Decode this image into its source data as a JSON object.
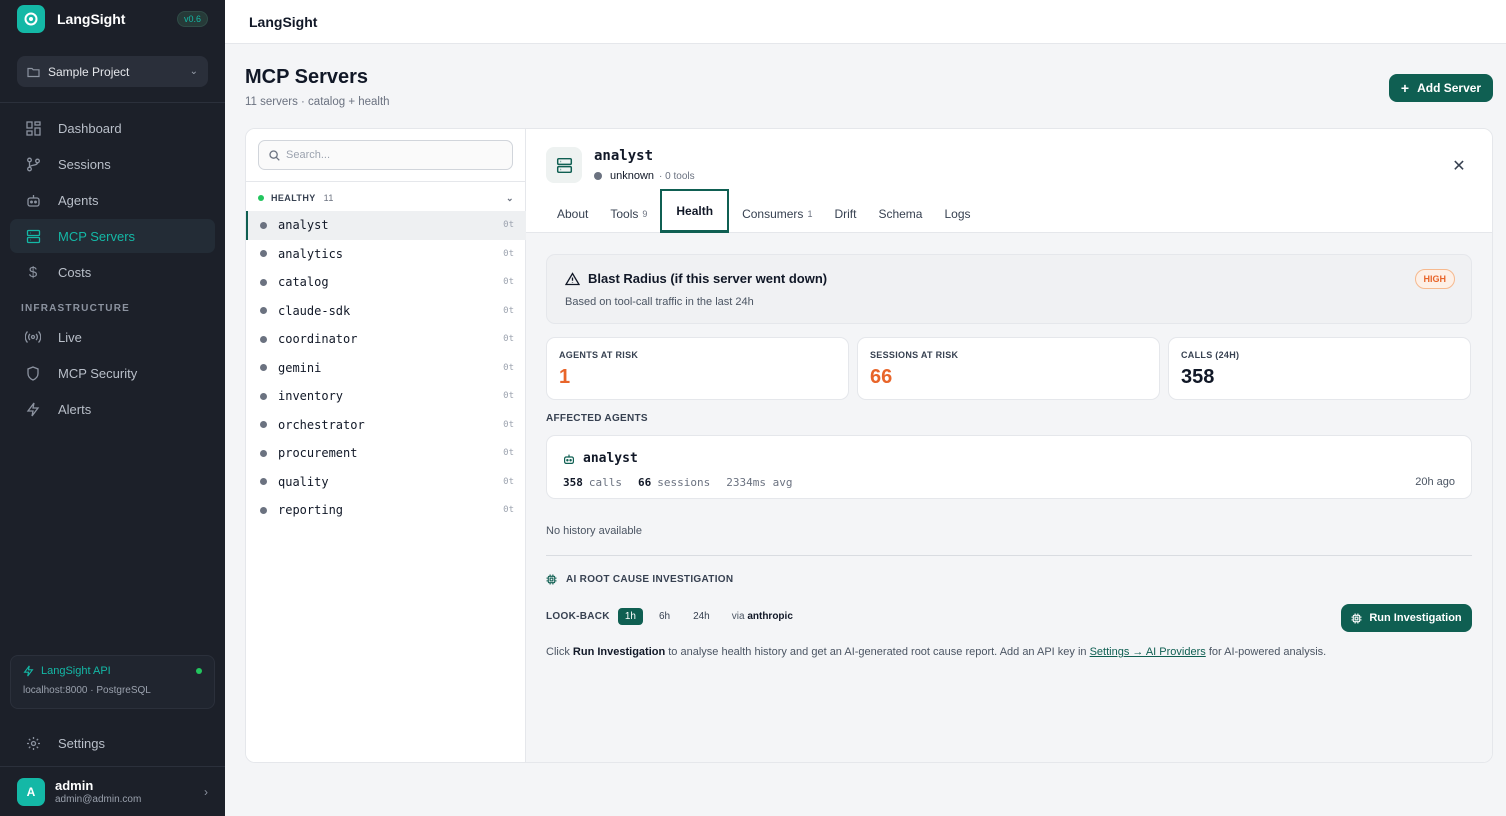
{
  "app": {
    "name": "LangSight",
    "version": "v0.6"
  },
  "project": {
    "name": "Sample Project"
  },
  "nav": {
    "items": [
      {
        "label": "Dashboard"
      },
      {
        "label": "Sessions"
      },
      {
        "label": "Agents"
      },
      {
        "label": "MCP Servers"
      },
      {
        "label": "Costs"
      }
    ],
    "infra_label": "INFRASTRUCTURE",
    "infra_items": [
      {
        "label": "Live"
      },
      {
        "label": "MCP Security"
      },
      {
        "label": "Alerts"
      }
    ],
    "settings_label": "Settings"
  },
  "api_status": {
    "title": "LangSight API",
    "detail": "localhost:8000 · PostgreSQL",
    "status_color": "#22c55e"
  },
  "user": {
    "initial": "A",
    "name": "admin",
    "email": "admin@admin.com"
  },
  "topbar": {
    "title": "LangSight"
  },
  "page": {
    "title": "MCP Servers",
    "subtitle": "11 servers · catalog + health",
    "add_button": "Add Server"
  },
  "search": {
    "placeholder": "Search..."
  },
  "group": {
    "label": "HEALTHY",
    "count": "11"
  },
  "servers": [
    {
      "name": "analyst",
      "tools": "0t"
    },
    {
      "name": "analytics",
      "tools": "0t"
    },
    {
      "name": "catalog",
      "tools": "0t"
    },
    {
      "name": "claude-sdk",
      "tools": "0t"
    },
    {
      "name": "coordinator",
      "tools": "0t"
    },
    {
      "name": "gemini",
      "tools": "0t"
    },
    {
      "name": "inventory",
      "tools": "0t"
    },
    {
      "name": "orchestrator",
      "tools": "0t"
    },
    {
      "name": "procurement",
      "tools": "0t"
    },
    {
      "name": "quality",
      "tools": "0t"
    },
    {
      "name": "reporting",
      "tools": "0t"
    }
  ],
  "detail": {
    "name": "analyst",
    "status": "unknown",
    "meta": "· 0 tools",
    "tabs": [
      {
        "label": "About",
        "count": ""
      },
      {
        "label": "Tools",
        "count": "9"
      },
      {
        "label": "Health",
        "count": ""
      },
      {
        "label": "Consumers",
        "count": "1"
      },
      {
        "label": "Drift",
        "count": ""
      },
      {
        "label": "Schema",
        "count": ""
      },
      {
        "label": "Logs",
        "count": ""
      }
    ],
    "active_tab": "Health"
  },
  "blast": {
    "title": "Blast Radius (if this server went down)",
    "subtitle": "Based on tool-call traffic in the last 24h",
    "severity": "HIGH"
  },
  "stats": [
    {
      "label": "AGENTS AT RISK",
      "value": "1"
    },
    {
      "label": "SESSIONS AT RISK",
      "value": "66"
    },
    {
      "label": "CALLS (24H)",
      "value": "358"
    }
  ],
  "affected": {
    "label": "AFFECTED AGENTS",
    "agent": {
      "name": "analyst",
      "calls_value": "358",
      "calls_unit": "calls",
      "sessions_value": "66",
      "sessions_unit": "sessions",
      "avg": "2334ms avg",
      "time": "20h ago"
    }
  },
  "history": {
    "empty": "No history available"
  },
  "investigation": {
    "title": "AI ROOT CAUSE INVESTIGATION",
    "lookback_label": "LOOK-BACK",
    "options": [
      "1h",
      "6h",
      "24h"
    ],
    "selected": "1h",
    "via_prefix": "via",
    "provider": "anthropic",
    "run_button": "Run Investigation",
    "help_prefix": "Click",
    "help_bold": "Run Investigation",
    "help_mid": "to analyse health history and get an AI-generated root cause report. Add an API key in",
    "help_link": "Settings → AI Providers",
    "help_suffix": "for AI-powered analysis."
  }
}
